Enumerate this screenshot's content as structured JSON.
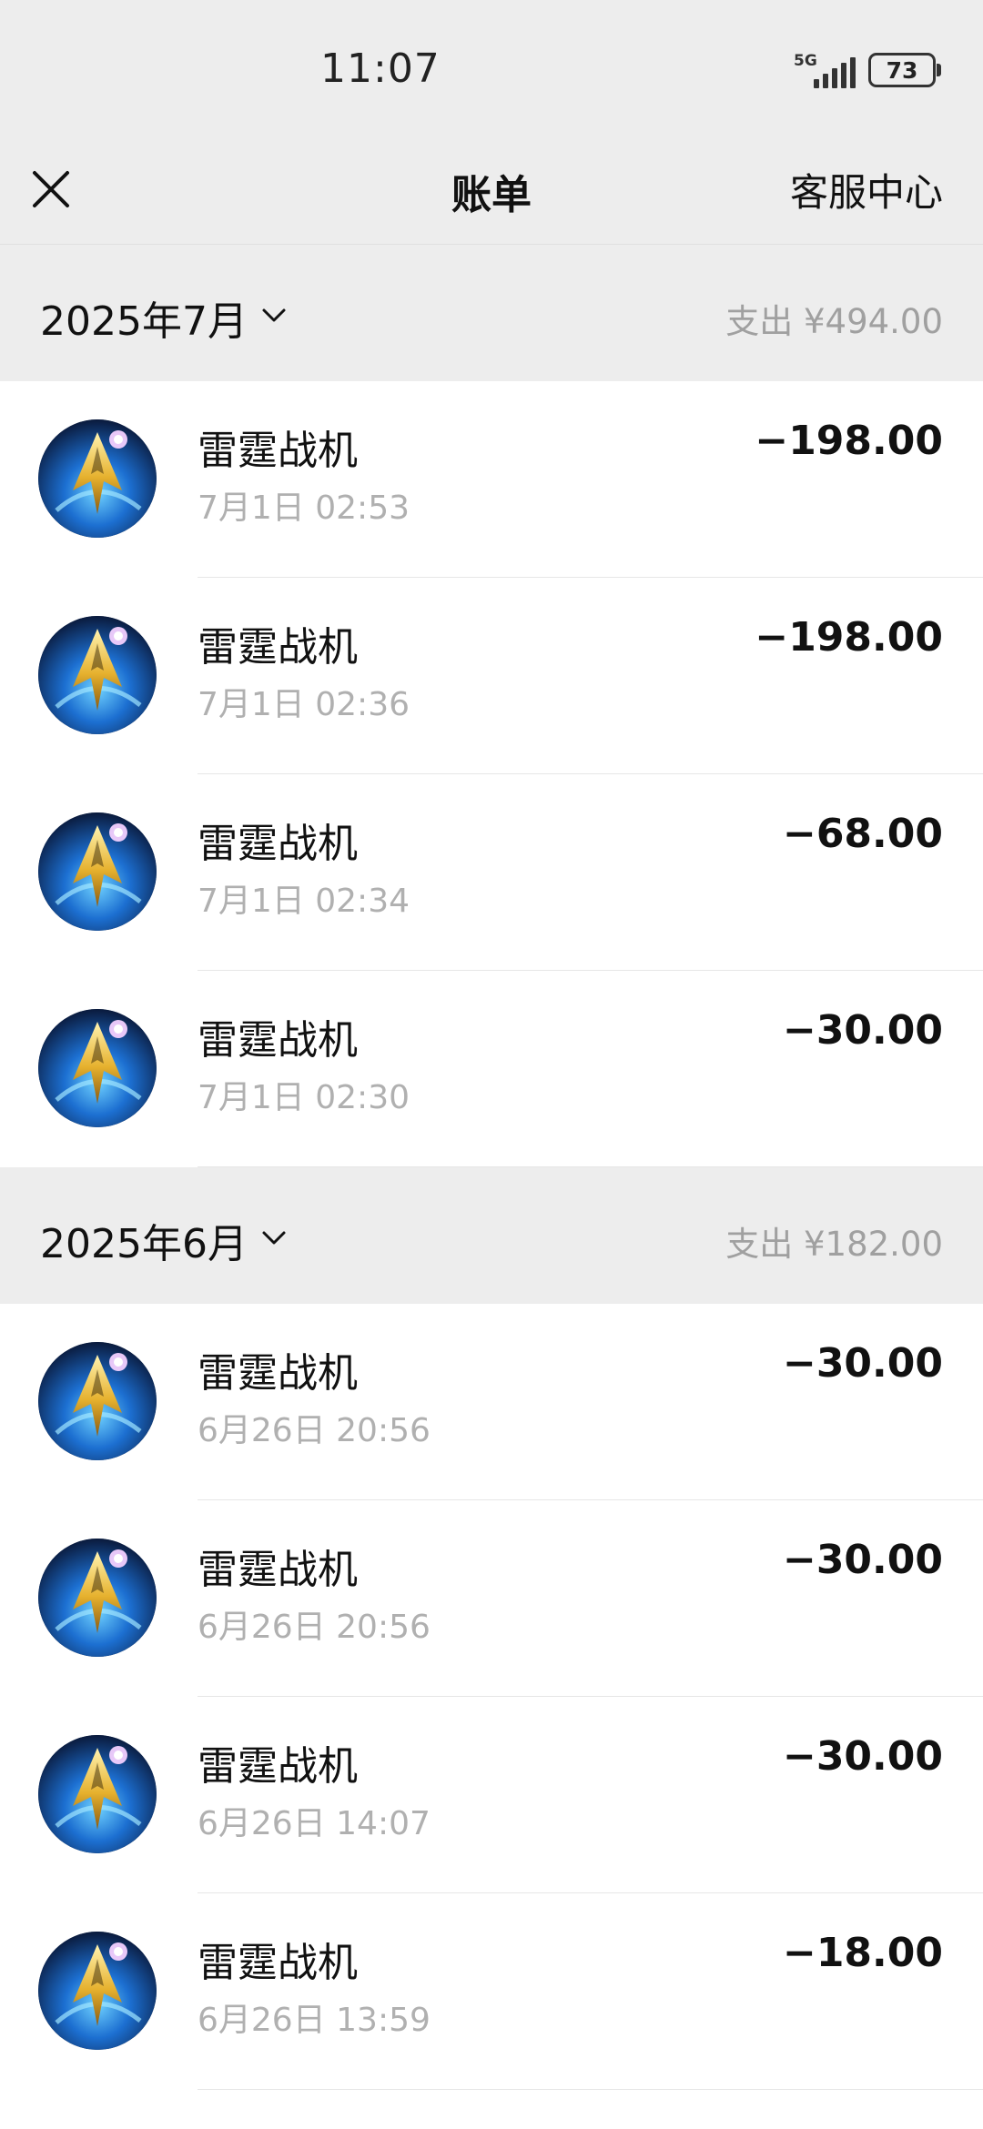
{
  "status_bar": {
    "time": "11:07",
    "network": "5G",
    "battery": "73"
  },
  "nav": {
    "title": "账单",
    "service_label": "客服中心",
    "close_icon": "close-icon"
  },
  "months": [
    {
      "label": "2025年7月",
      "summary": "支出 ¥494.00",
      "transactions": [
        {
          "name": "雷霆战机",
          "time": "7月1日 02:53",
          "amount": "−198.00"
        },
        {
          "name": "雷霆战机",
          "time": "7月1日 02:36",
          "amount": "−198.00"
        },
        {
          "name": "雷霆战机",
          "time": "7月1日 02:34",
          "amount": "−68.00"
        },
        {
          "name": "雷霆战机",
          "time": "7月1日 02:30",
          "amount": "−30.00"
        }
      ]
    },
    {
      "label": "2025年6月",
      "summary": "支出 ¥182.00",
      "transactions": [
        {
          "name": "雷霆战机",
          "time": "6月26日 20:56",
          "amount": "−30.00"
        },
        {
          "name": "雷霆战机",
          "time": "6月26日 20:56",
          "amount": "−30.00"
        },
        {
          "name": "雷霆战机",
          "time": "6月26日 14:07",
          "amount": "−30.00"
        },
        {
          "name": "雷霆战机",
          "time": "6月26日 13:59",
          "amount": "−18.00"
        }
      ]
    }
  ]
}
